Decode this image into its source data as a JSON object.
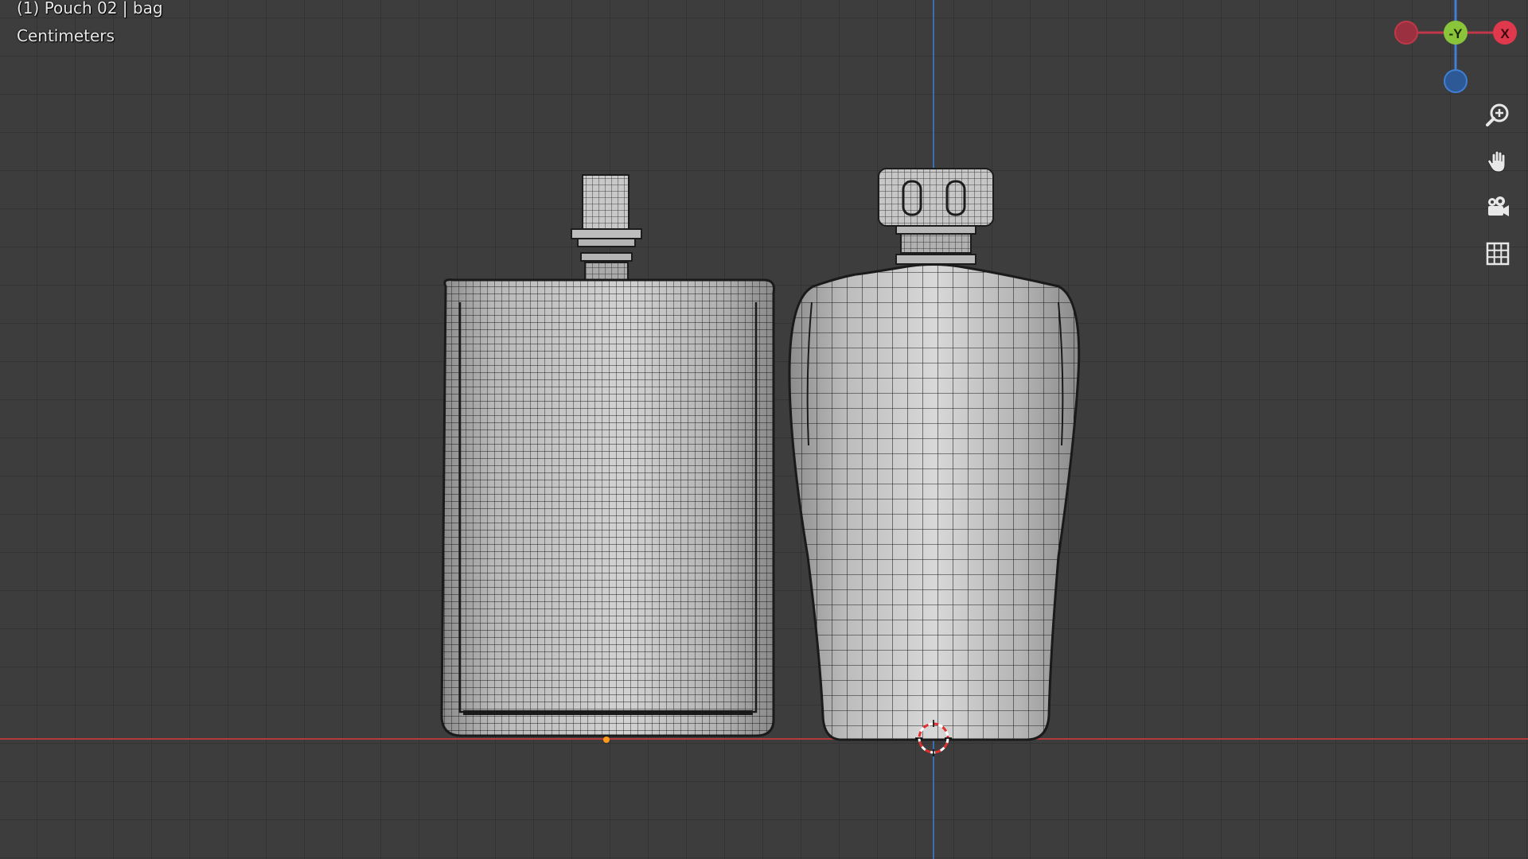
{
  "viewport": {
    "object_info": "(1) Pouch 02 | bag",
    "unit_label": "Centimeters"
  },
  "nav_gizmo": {
    "y_axis_label": "-Y",
    "x_axis_label": "X",
    "colors": {
      "x_axis": "#e0384c",
      "y_axis": "#8ac43a",
      "z_axis": "#3f7fd6",
      "neg_x_axis": "#9a3040"
    }
  },
  "toolbar": {
    "items": [
      {
        "icon": "zoom-icon"
      },
      {
        "icon": "hand-pan-icon"
      },
      {
        "icon": "camera-icon"
      },
      {
        "icon": "grid-ortho-icon"
      }
    ]
  },
  "colors": {
    "background": "#3d3d3d",
    "grid_line": "#333333",
    "x_axis_line": "#b23a3a",
    "z_axis_line": "#3d6fb0",
    "mesh_fill": "#c4c4c4",
    "wire": "#1c1c1c",
    "origin_dot": "#ff9a1a"
  }
}
